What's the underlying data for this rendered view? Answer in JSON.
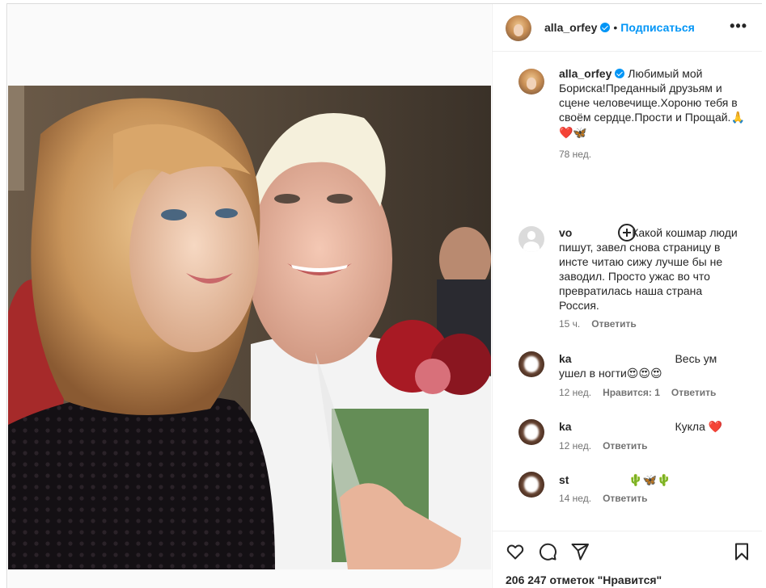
{
  "post": {
    "author": "alla_orfey",
    "follow_label": "Подписаться",
    "more_label": "•••",
    "caption": {
      "username": "alla_orfey",
      "text": "Любимый мой Бориска!Преданный друзьям и сцене человечище.Хороню тебя в своём сердце.Прости и Прощай.",
      "emoji": "🙏❤️🦋",
      "time": "78 нед."
    },
    "likes_text": "206 247 отметок \"Нравится\""
  },
  "comments": [
    {
      "username": "vo",
      "text": "Какой кошмар люди пишут, завел снова страницу в инсте читаю сижу лучше бы не заводил. Просто ужас во что превратилась наша страна Россия.",
      "time": "15 ч.",
      "likes": "",
      "reply_label": "Ответить"
    },
    {
      "username": "ka",
      "text": "Весь ум ушел в ногти",
      "emoji": "😍😍😍",
      "time": "12 нед.",
      "likes": "Нравится: 1",
      "reply_label": "Ответить"
    },
    {
      "username": "ka",
      "text": "Кукла",
      "emoji": "❤️",
      "time": "12 нед.",
      "likes": "",
      "reply_label": "Ответить"
    },
    {
      "username": "st",
      "text": "",
      "emoji": "🌵🦋🌵",
      "time": "14 нед.",
      "likes": "",
      "reply_label": "Ответить"
    }
  ],
  "icons": {
    "like": "heart-icon",
    "comment": "comment-icon",
    "share": "paper-plane-icon",
    "save": "bookmark-icon",
    "load_more": "plus-circle-icon"
  },
  "colors": {
    "accent": "#0095f6",
    "text": "#262626",
    "muted": "#737373",
    "heart": "#ed4956"
  }
}
